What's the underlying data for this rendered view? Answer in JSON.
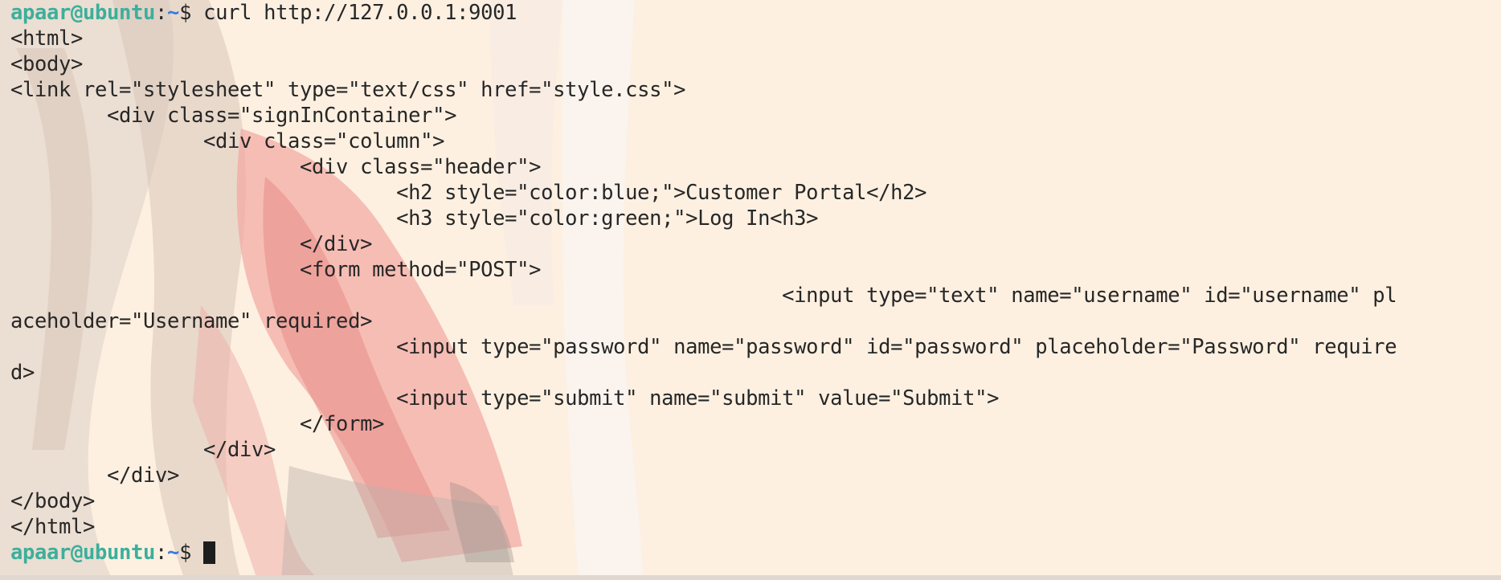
{
  "prompt": {
    "user_host": "apaar@ubuntu",
    "colon": ":",
    "path": "~",
    "symbol": "$ ",
    "colors": {
      "user_host": "#3caf9b",
      "path": "#3c7be3",
      "text": "#272727"
    }
  },
  "command": "curl http://127.0.0.1:9001",
  "output_lines": [
    "<html>",
    "<body>",
    "<link rel=\"stylesheet\" type=\"text/css\" href=\"style.css\">",
    "        <div class=\"signInContainer\">",
    "                <div class=\"column\">",
    "                        <div class=\"header\">",
    "                                <h2 style=\"color:blue;\">Customer Portal</h2>",
    "                                <h3 style=\"color:green;\">Log In<h3>",
    "                        </div>",
    "                        <form method=\"POST\">",
    "                                                                <input type=\"text\" name=\"username\" id=\"username\" pl",
    "aceholder=\"Username\" required>",
    "                                <input type=\"password\" name=\"password\" id=\"password\" placeholder=\"Password\" require",
    "d>",
    "                                <input type=\"submit\" name=\"submit\" value=\"Submit\">",
    "                        </form>",
    "                </div>",
    "        </div>",
    "</body>",
    "</html>"
  ],
  "wallpaper_icon": "anime-artwork-illustration"
}
